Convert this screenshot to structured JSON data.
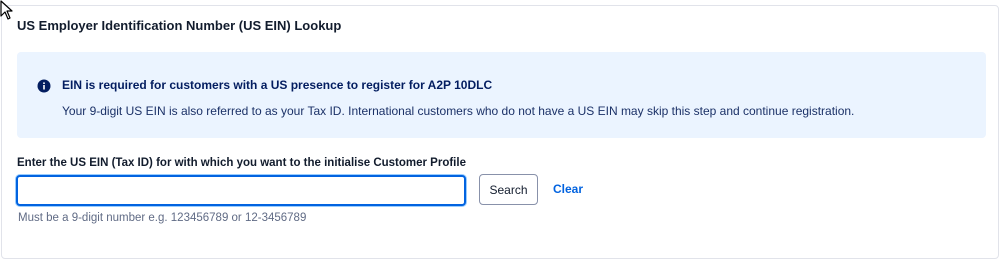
{
  "section": {
    "title": "US Employer Identification Number (US EIN) Lookup"
  },
  "callout": {
    "icon": "info-icon",
    "heading": "EIN is required for customers with a US presence to register for A2P 10DLC",
    "body": "Your 9-digit US EIN is also referred to as your Tax ID. International customers who do not have a US EIN may skip this step and continue registration."
  },
  "form": {
    "label": "Enter the US EIN (Tax ID) for with which you want to the initialise Customer Profile",
    "input_value": "",
    "search_label": "Search",
    "clear_label": "Clear",
    "help_text": "Must be a 9-digit number e.g. 123456789 or 12-3456789"
  },
  "colors": {
    "accent": "#0263e0",
    "callout_bg": "#ebf4ff",
    "callout_icon": "#031d60"
  }
}
